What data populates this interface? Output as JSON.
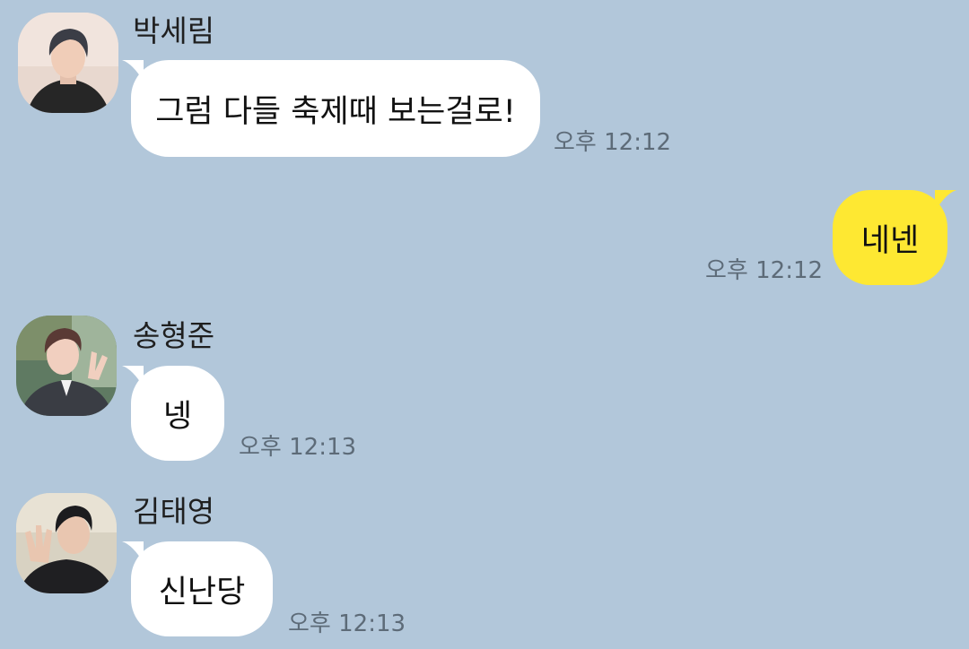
{
  "messages": [
    {
      "sender": "박세림",
      "text": "그럼 다들 축제때 보는걸로!",
      "time": "오후 12:12",
      "side": "in",
      "avatar": "profile-photo-sender-1"
    },
    {
      "text": "네넨",
      "time": "오후 12:12",
      "side": "out"
    },
    {
      "sender": "송형준",
      "text": "넹",
      "time": "오후 12:13",
      "side": "in",
      "avatar": "profile-photo-sender-2"
    },
    {
      "sender": "김태영",
      "text": "신난당",
      "time": "오후 12:13",
      "side": "in",
      "avatar": "profile-photo-sender-3"
    }
  ],
  "colors": {
    "background": "#b2c7da",
    "incoming_bubble": "#ffffff",
    "outgoing_bubble": "#fee832",
    "timestamp": "#5d6b78"
  }
}
